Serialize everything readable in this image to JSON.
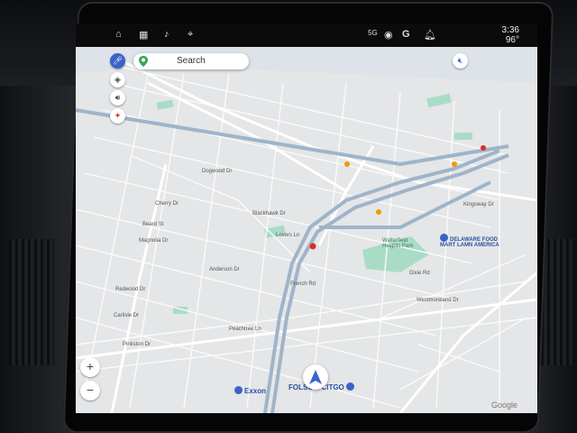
{
  "status_bar": {
    "network": "5G",
    "assistant_letter": "G",
    "time": "3:36",
    "temperature": "96°"
  },
  "search": {
    "placeholder": "Search"
  },
  "zoom": {
    "in": "+",
    "out": "−"
  },
  "map": {
    "streets": [
      "Dogwood Dr",
      "Cherry Dr",
      "Beard St",
      "Magnolia Dr",
      "Redwood Dr",
      "Carlisle Dr",
      "Pinkston Dr",
      "Anderson Dr",
      "French Rd",
      "Lovers Ln",
      "Kingsway Dr",
      "Dixie Rd",
      "Westmoreland Dr",
      "Peachtree Ln",
      "Blackhawk Dr"
    ],
    "places": [
      "Walterfield Heights Park",
      "DELAWARE FOOD MART LAMN AMERICA",
      "Exxon",
      "FOLSOM CITGO"
    ],
    "attribution": "Google"
  },
  "colors": {
    "map_bg": "#e6e8ea",
    "highway": "#9fb4c9",
    "park": "#a9dcc6",
    "poi": "#3b62c7",
    "marker_red": "#d93025",
    "marker_orange": "#f29900"
  }
}
